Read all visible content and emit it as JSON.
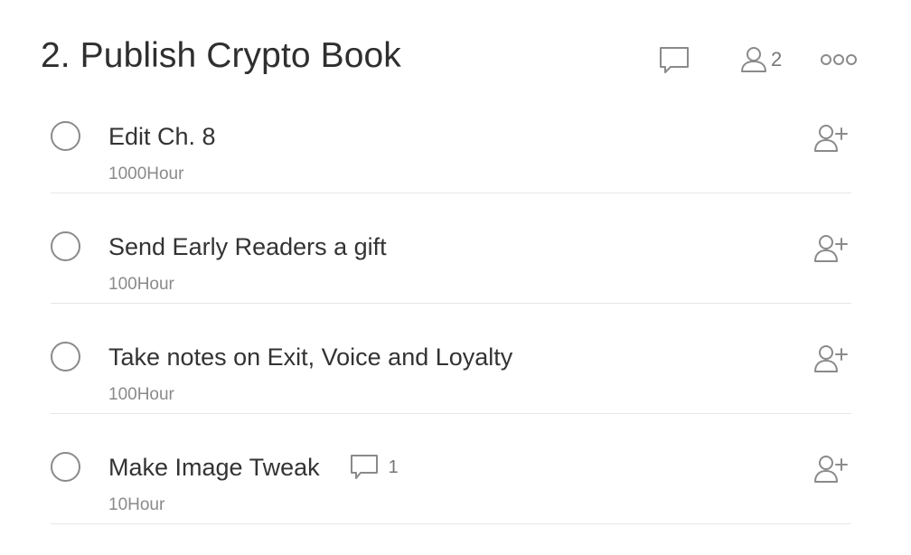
{
  "header": {
    "title": "2. Publish Crypto Book",
    "member_count": "2",
    "icons": {
      "comment": "comment-icon",
      "members": "members-icon",
      "more": "more-options-icon"
    }
  },
  "tasks": [
    {
      "title": "Edit Ch. 8",
      "hours": "1000Hour",
      "comment_count": null,
      "assign_icon": "assign-user-icon"
    },
    {
      "title": "Send Early Readers a gift",
      "hours": "100Hour",
      "comment_count": null,
      "assign_icon": "assign-user-icon"
    },
    {
      "title": "Take notes on Exit, Voice and Loyalty",
      "hours": "100Hour",
      "comment_count": null,
      "assign_icon": "assign-user-icon"
    },
    {
      "title": "Make Image Tweak",
      "hours": "10Hour",
      "comment_count": "1",
      "assign_icon": "assign-user-icon"
    }
  ],
  "colors": {
    "text": "#333333",
    "muted": "#8a8a8a",
    "divider": "#e6e6e6",
    "icon": "#8a8a8a"
  }
}
